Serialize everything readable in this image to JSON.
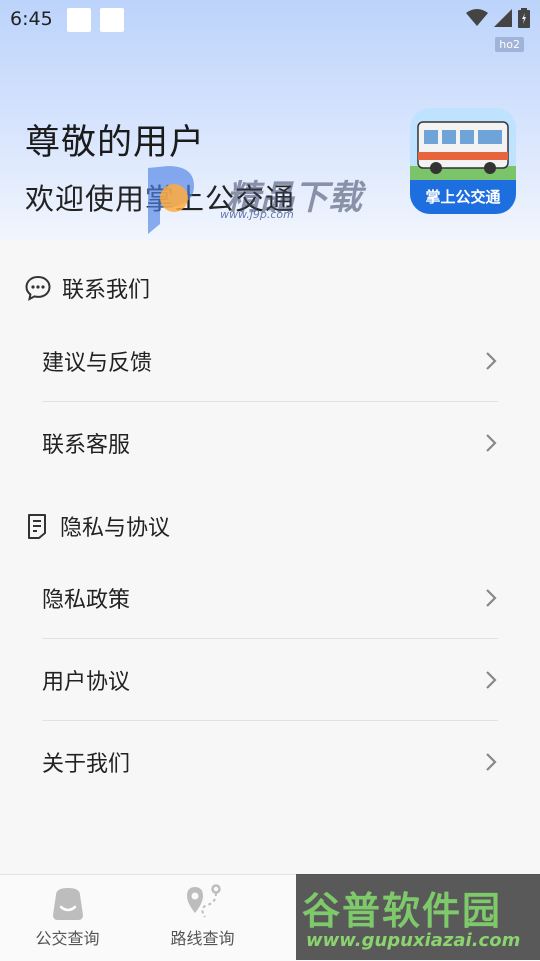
{
  "status_bar": {
    "time": "6:45",
    "tag": "ho2"
  },
  "header": {
    "title": "尊敬的用户",
    "subtitle": "欢迎使用掌上公交通",
    "logo_label": "掌上公交通"
  },
  "watermarks": {
    "top_text": "精品下载",
    "top_url": "www.j9p.com",
    "bottom_text": "谷普软件园",
    "bottom_url": "www.gupuxiazai.com"
  },
  "sections": [
    {
      "title": "联系我们",
      "icon": "chat-bubble-icon",
      "items": [
        {
          "label": "建议与反馈"
        },
        {
          "label": "联系客服"
        }
      ]
    },
    {
      "title": "隐私与协议",
      "icon": "document-icon",
      "items": [
        {
          "label": "隐私政策"
        },
        {
          "label": "用户协议"
        },
        {
          "label": "关于我们"
        }
      ]
    }
  ],
  "tabs": [
    {
      "label": "公交查询",
      "icon": "bus-stop-icon"
    },
    {
      "label": "路线查询",
      "icon": "route-pin-icon"
    },
    {
      "label": "",
      "icon": "hidden-tab-icon"
    },
    {
      "label": "",
      "icon": "hidden-tab-icon"
    }
  ],
  "colors": {
    "accent": "#1d6fe0",
    "header_top": "#bcd3fb",
    "background": "#f7f7f8"
  }
}
